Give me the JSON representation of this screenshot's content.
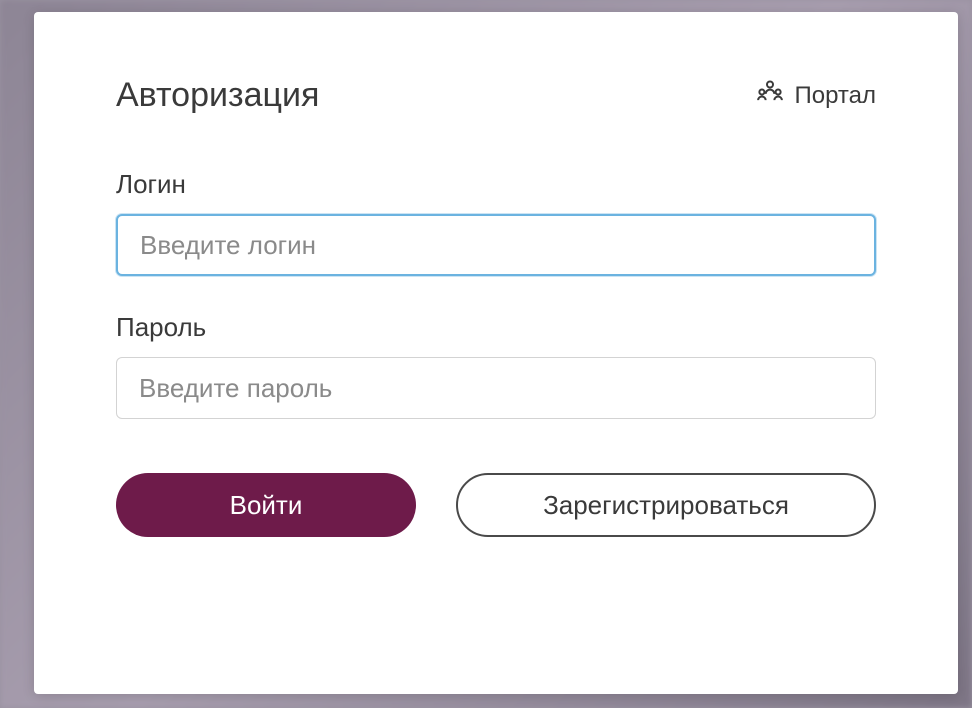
{
  "header": {
    "title": "Авторизация",
    "portal_label": "Портал"
  },
  "fields": {
    "login": {
      "label": "Логин",
      "placeholder": "Введите логин",
      "value": ""
    },
    "password": {
      "label": "Пароль",
      "placeholder": "Введите пароль",
      "value": ""
    }
  },
  "buttons": {
    "submit": "Войти",
    "register": "Зарегистрироваться"
  },
  "colors": {
    "primary": "#6e1b4a",
    "focus_border": "#6bb3e0",
    "text": "#3a3a3a"
  }
}
